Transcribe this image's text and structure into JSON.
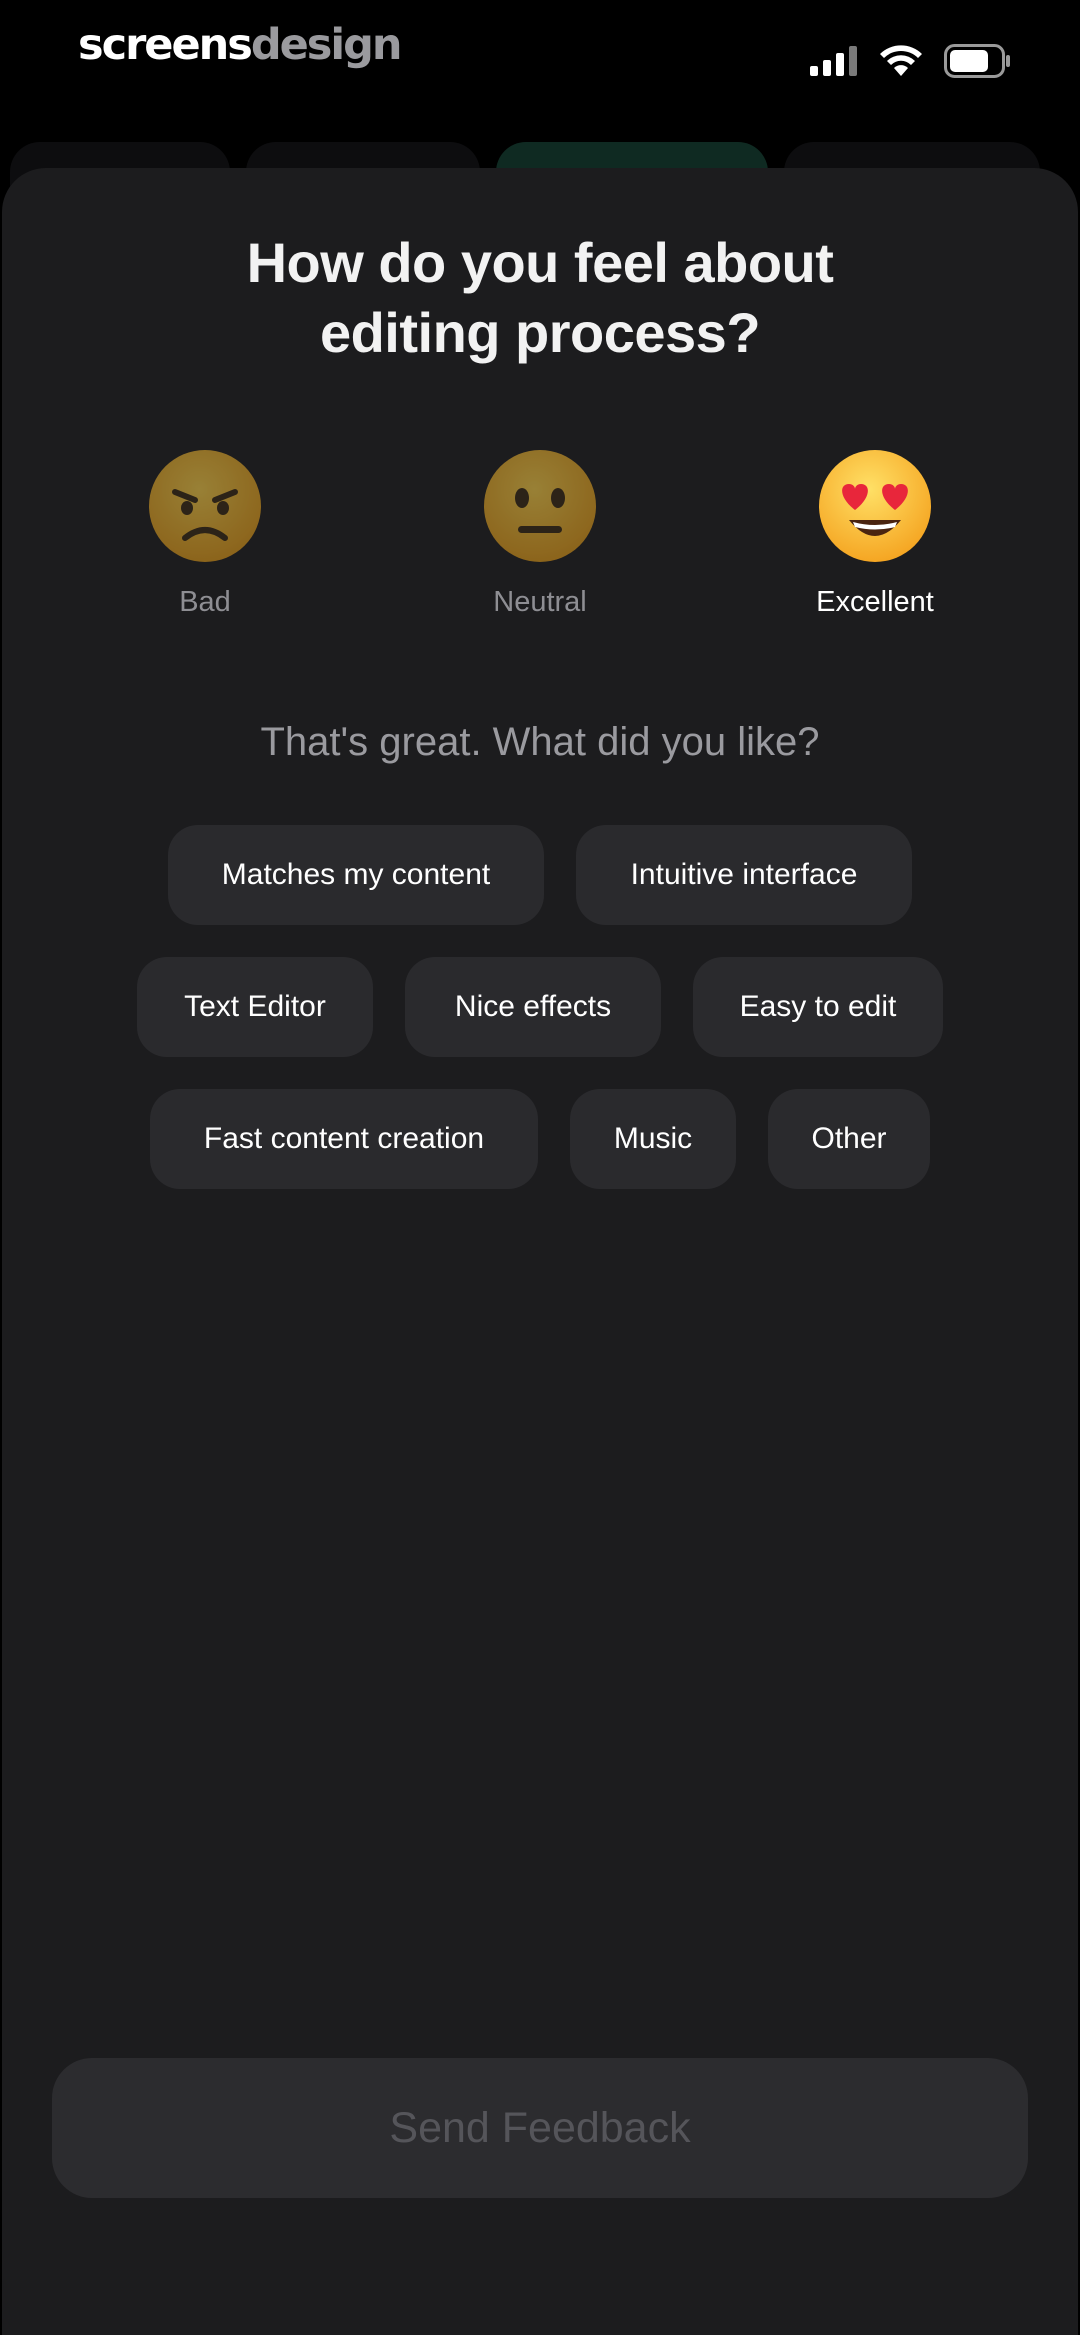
{
  "status_bar": {
    "brand_part1": "screens",
    "brand_part2": "design"
  },
  "title_line1": "How do you feel about",
  "title_line2": "editing process?",
  "ratings": [
    {
      "label": "Bad",
      "icon": "angry-face-icon",
      "selected": false
    },
    {
      "label": "Neutral",
      "icon": "neutral-face-icon",
      "selected": false
    },
    {
      "label": "Excellent",
      "icon": "heart-eyes-face-icon",
      "selected": true
    }
  ],
  "subtitle": "That's great. What did you like?",
  "chips": [
    "Matches my content",
    "Intuitive interface",
    "Text Editor",
    "Nice effects",
    "Easy to edit",
    "Fast content creation",
    "Music",
    "Other"
  ],
  "send_button": "Send Feedback",
  "colors": {
    "background": "#000000",
    "sheet": "#1c1c1e",
    "chip": "#2a2a2d",
    "accent_tab": "#0f2a22"
  }
}
